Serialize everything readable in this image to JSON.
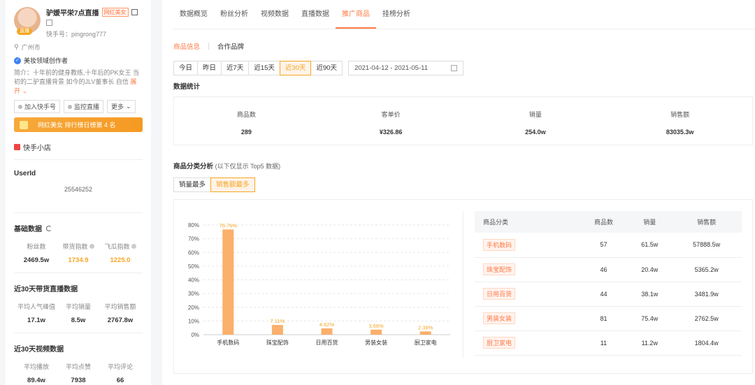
{
  "profile": {
    "name": "驴媛平栄7点直播",
    "tag": "网红美女",
    "avatar_badge": "直播",
    "account": "快手号：pingrong777",
    "location": "广州市",
    "creator": "美妆领域创作者",
    "intro": "简介：十年前的健身教练,十年后的PK女王 当初的二驴直播背景 如今的JLV董事长 自信",
    "expand": "展开",
    "buttons": [
      "加入快手号",
      "监控直播",
      "更多"
    ],
    "rank_text": "网红美女 排行榜日榜第 4 名",
    "shop": "快手小店"
  },
  "userid": {
    "label": "UserId",
    "value": "25546252"
  },
  "basic": {
    "title": "基础数据",
    "stats": [
      {
        "label": "粉丝数",
        "value": "2469.5w"
      },
      {
        "label": "带货指数",
        "value": "1734.9"
      },
      {
        "label": "飞瓜指数",
        "value": "1225.0"
      }
    ]
  },
  "live30": {
    "title": "近30天带货直播数据",
    "stats": [
      {
        "label": "平均人气峰值",
        "value": "17.1w"
      },
      {
        "label": "平均销量",
        "value": "8.5w"
      },
      {
        "label": "平均销售额",
        "value": "2767.8w"
      }
    ]
  },
  "video30": {
    "title": "近30天视频数据",
    "stats": [
      {
        "label": "平均播放",
        "value": "89.4w"
      },
      {
        "label": "平均点赞",
        "value": "7938"
      },
      {
        "label": "平均评论",
        "value": "66"
      }
    ]
  },
  "tabs": [
    "数据概览",
    "粉丝分析",
    "视频数据",
    "直播数据",
    "推广商品",
    "挂榜分析"
  ],
  "subtabs": [
    "商品信息",
    "合作品牌"
  ],
  "date_buttons": [
    "今日",
    "昨日",
    "近7天",
    "近15天",
    "近30天",
    "近90天"
  ],
  "date_range": "2021-04-12  -  2021-05-11",
  "stats_title": "数据统计",
  "stats": [
    {
      "label": "商品数",
      "value": "289"
    },
    {
      "label": "客单价",
      "value": "¥326.86"
    },
    {
      "label": "销量",
      "value": "254.0w"
    },
    {
      "label": "销售额",
      "value": "83035.3w"
    }
  ],
  "cat_title": "商品分类分析",
  "cat_note": "(以下仅显示 Top5 数据)",
  "toggle": [
    "销量最多",
    "销售额最多"
  ],
  "table": {
    "headers": [
      "商品分类",
      "商品数",
      "销量",
      "销售额"
    ],
    "rows": [
      [
        "手机数码",
        "57",
        "61.5w",
        "57888.5w"
      ],
      [
        "珠宝配饰",
        "46",
        "20.4w",
        "5365.2w"
      ],
      [
        "日用百货",
        "44",
        "38.1w",
        "3481.9w"
      ],
      [
        "男装女装",
        "81",
        "75.4w",
        "2762.5w"
      ],
      [
        "厨卫家电",
        "11",
        "11.2w",
        "1804.4w"
      ]
    ]
  },
  "colors": {
    "accent": "#ff7a45",
    "bar": "#fbb06b"
  },
  "chart_data": {
    "type": "bar",
    "categories": [
      "手机数码",
      "珠宝配饰",
      "日用百货",
      "男装女装",
      "厨卫家电"
    ],
    "values": [
      76.76,
      7.11,
      4.62,
      3.66,
      2.39
    ],
    "labels": [
      "76.76%",
      "7.11%",
      "4.62%",
      "3.66%",
      "2.39%"
    ],
    "yticks": [
      "0%",
      "10%",
      "20%",
      "30%",
      "40%",
      "50%",
      "60%",
      "70%",
      "80%"
    ],
    "ylim": [
      0,
      80
    ],
    "grid": true
  }
}
